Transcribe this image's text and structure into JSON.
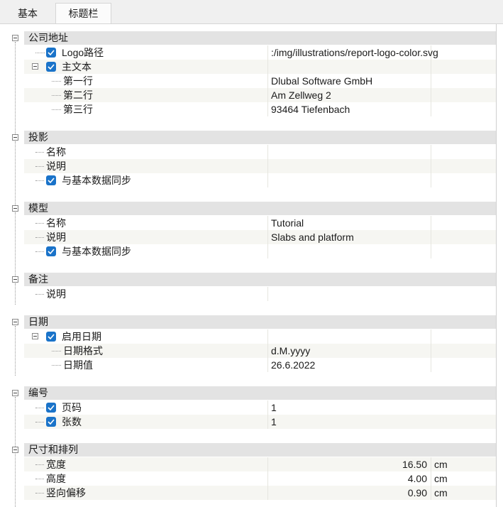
{
  "tabs": [
    "基本",
    "标题栏"
  ],
  "sections": {
    "address": {
      "title": "公司地址",
      "logo_label": "Logo路径",
      "logo_value": ":/img/illustrations/report-logo-color.svg",
      "main_text_label": "主文本",
      "line1_label": "第一行",
      "line1_value": "Dlubal Software GmbH",
      "line2_label": "第二行",
      "line2_value": "Am Zellweg 2",
      "line3_label": "第三行",
      "line3_value": "93464 Tiefenbach"
    },
    "projection": {
      "title": "投影",
      "name_label": "名称",
      "desc_label": "说明",
      "sync_label": "与基本数据同步"
    },
    "model": {
      "title": "模型",
      "name_label": "名称",
      "name_value": "Tutorial",
      "desc_label": "说明",
      "desc_value": "Slabs and platform",
      "sync_label": "与基本数据同步"
    },
    "notes": {
      "title": "备注",
      "desc_label": "说明"
    },
    "date": {
      "title": "日期",
      "enable_label": "启用日期",
      "format_label": "日期格式",
      "format_value": "d.M.yyyy",
      "value_label": "日期值",
      "value_value": "26.6.2022"
    },
    "numbering": {
      "title": "编号",
      "page_label": "页码",
      "page_value": "1",
      "sheet_label": "张数",
      "sheet_value": "1"
    },
    "size": {
      "title": "尺寸和排列",
      "width_label": "宽度",
      "width_value": "16.50",
      "width_unit": "cm",
      "height_label": "高度",
      "height_value": "4.00",
      "height_unit": "cm",
      "offset_label": "竖向偏移",
      "offset_value": "0.90",
      "offset_unit": "cm"
    }
  },
  "colors": {
    "checkbox": "#1a73c9",
    "section_header": "#e3e3e3",
    "row_alt": "#f6f6f2"
  }
}
